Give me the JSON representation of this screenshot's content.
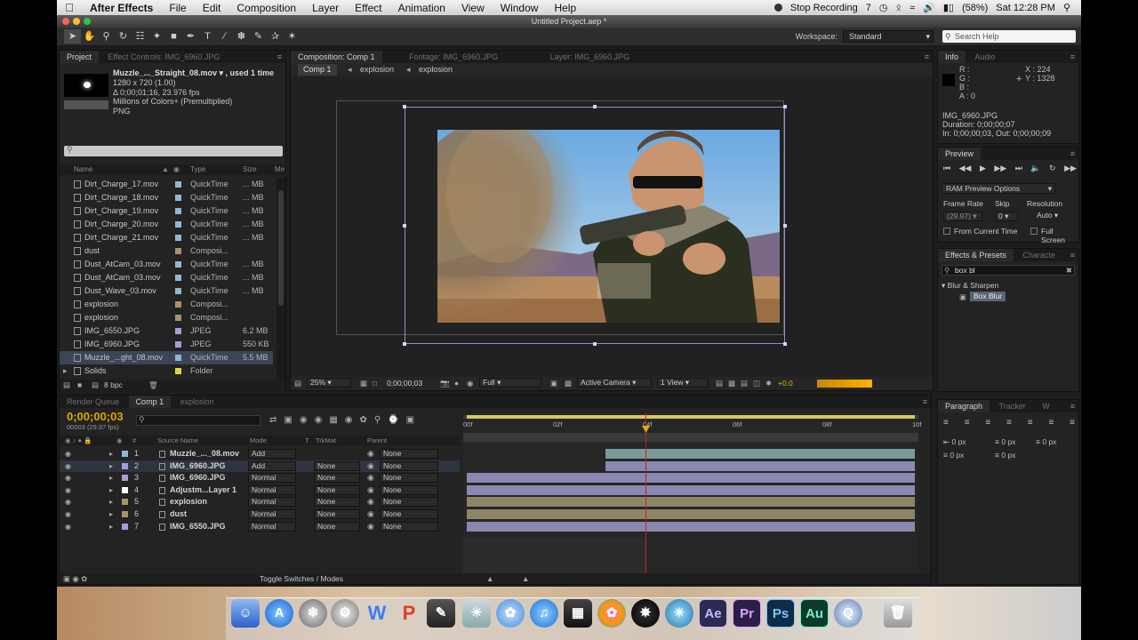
{
  "menubar": {
    "app_name": "After Effects",
    "items": [
      "File",
      "Edit",
      "Composition",
      "Layer",
      "Effect",
      "Animation",
      "View",
      "Window",
      "Help"
    ],
    "stop_recording": "Stop Recording",
    "battery": "(58%)",
    "clock": "Sat 12:28 PM",
    "extra_num": "7"
  },
  "window": {
    "title": "Untitled Project.aep *"
  },
  "toolbar": {
    "workspace_label": "Workspace:",
    "workspace_value": "Standard",
    "search_placeholder": "Search Help"
  },
  "project_panel": {
    "tabs": [
      "Project",
      "Effect Controls: IMG_6960.JPG"
    ],
    "preview_name": "Muzzle_..._Straight_08.mov ▾ , used 1 time",
    "preview_info": [
      "1280 x 720 (1.00)",
      "Δ 0;00;01;16, 23.976 fps",
      "Millions of Colors+ (Premultiplied)",
      "PNG"
    ],
    "columns": {
      "name": "Name",
      "type": "Type",
      "size": "Size",
      "media": "Me"
    },
    "items": [
      {
        "name": "Dirt_Charge_17.mov",
        "type": "QuickTime",
        "size": "... MB",
        "label": "#8fb8d1"
      },
      {
        "name": "Dirt_Charge_18.mov",
        "type": "QuickTime",
        "size": "... MB",
        "label": "#8fb8d1"
      },
      {
        "name": "Dirt_Charge_19.mov",
        "type": "QuickTime",
        "size": "... MB",
        "label": "#8fb8d1"
      },
      {
        "name": "Dirt_Charge_20.mov",
        "type": "QuickTime",
        "size": "... MB",
        "label": "#8fb8d1"
      },
      {
        "name": "Dirt_Charge_21.mov",
        "type": "QuickTime",
        "size": "... MB",
        "label": "#8fb8d1"
      },
      {
        "name": "dust",
        "type": "Composi...",
        "size": "",
        "label": "#a7956a"
      },
      {
        "name": "Dust_AtCam_03.mov",
        "type": "QuickTime",
        "size": "... MB",
        "label": "#8fb8d1"
      },
      {
        "name": "Dust_AtCam_03.mov",
        "type": "QuickTime",
        "size": "... MB",
        "label": "#8fb8d1"
      },
      {
        "name": "Dust_Wave_03.mov",
        "type": "QuickTime",
        "size": "... MB",
        "label": "#8fb8d1"
      },
      {
        "name": "explosion",
        "type": "Composi...",
        "size": "",
        "label": "#a7956a"
      },
      {
        "name": "explosion",
        "type": "Composi...",
        "size": "",
        "label": "#a7956a"
      },
      {
        "name": "IMG_6550.JPG",
        "type": "JPEG",
        "size": "6.2 MB",
        "label": "#a99cd8"
      },
      {
        "name": "IMG_6960.JPG",
        "type": "JPEG",
        "size": "550 KB",
        "label": "#a99cd8"
      },
      {
        "name": "Muzzle_...ght_08.mov",
        "type": "QuickTime",
        "size": "5.5 MB",
        "label": "#8fb8d1"
      },
      {
        "name": "Solids",
        "type": "Folder",
        "size": "",
        "label": "#e3d24a"
      }
    ],
    "bpc": "8 bpc"
  },
  "comp_panel": {
    "tabs": [
      "Composition: Comp 1",
      "Footage: IMG_6960.JPG",
      "Layer: IMG_6960.JPG"
    ],
    "breadcrumbs": [
      "Comp 1",
      "explosion",
      "explosion"
    ],
    "zoom": "25%",
    "timecode": "0;00;00;03",
    "resolution": "Full",
    "camera": "Active Camera",
    "views": "1 View",
    "exposure": "+0.0"
  },
  "info_panel": {
    "tabs": [
      "Info",
      "Audio"
    ],
    "r": "R :",
    "g": "G :",
    "b": "B :",
    "a": "A : 0",
    "x": "X : 224",
    "y": "Y : 1328",
    "file": "IMG_6960.JPG",
    "duration": "Duration: 0;00;00;07",
    "inout": "In: 0;00;00;03, Out: 0;00;00;09"
  },
  "preview_panel": {
    "title": "Preview",
    "ram_options": "RAM Preview Options",
    "frame_rate_label": "Frame Rate",
    "skip_label": "Skip",
    "resolution_label": "Resolution",
    "frame_rate": "(29.97)",
    "skip": "0",
    "resolution": "Auto",
    "from_current": "From Current Time",
    "full_screen": "Full Screen"
  },
  "effects_panel": {
    "tabs": [
      "Effects & Presets",
      "Characte"
    ],
    "search": "box bl",
    "category": "Blur & Sharpen",
    "effect": "Box Blur"
  },
  "paragraph_panel": {
    "tabs": [
      "Paragraph",
      "Tracker",
      "W"
    ],
    "px": [
      "0 px",
      "0 px",
      "0 px",
      "0 px",
      "0 px"
    ]
  },
  "timeline": {
    "tabs": [
      "Render Queue",
      "Comp 1",
      "explosion"
    ],
    "timecode": "0;00;00;03",
    "frame_info": "00003 (29.97 fps)",
    "columns": {
      "source": "Source Name",
      "mode": "Mode",
      "t": "T",
      "trkmat": "TrkMat",
      "parent": "Parent"
    },
    "ruler": [
      "00f",
      "02f",
      "04f",
      "06f",
      "08f",
      "10f"
    ],
    "layers": [
      {
        "num": "1",
        "name": "Muzzle_..._08.mov",
        "mode": "Add",
        "trkmat": "",
        "parent": "None",
        "label": "#8fb8d1",
        "bar_color": "#7a9a97",
        "start": 0.31
      },
      {
        "num": "2",
        "name": "IMG_6960.JPG",
        "mode": "Add",
        "trkmat": "None",
        "parent": "None",
        "label": "#a99cd8",
        "bar_color": "#8a88b0",
        "start": 0.31
      },
      {
        "num": "3",
        "name": "IMG_6960.JPG",
        "mode": "Normal",
        "trkmat": "None",
        "parent": "None",
        "label": "#a99cd8",
        "bar_color": "#8a88b0",
        "start": 0.0
      },
      {
        "num": "4",
        "name": "Adjustm...Layer 1",
        "mode": "Normal",
        "trkmat": "None",
        "parent": "None",
        "label": "#ffffff",
        "bar_color": "#8a88b0",
        "start": 0.0
      },
      {
        "num": "5",
        "name": "explosion",
        "mode": "Normal",
        "trkmat": "None",
        "parent": "None",
        "label": "#a7956a",
        "bar_color": "#8d8566",
        "start": 0.0
      },
      {
        "num": "6",
        "name": "dust",
        "mode": "Normal",
        "trkmat": "None",
        "parent": "None",
        "label": "#a7956a",
        "bar_color": "#8d8566",
        "start": 0.0
      },
      {
        "num": "7",
        "name": "IMG_6550.JPG",
        "mode": "Normal",
        "trkmat": "None",
        "parent": "None",
        "label": "#a99cd8",
        "bar_color": "#8a88b0",
        "start": 0.0
      }
    ],
    "toggle": "Toggle Switches / Modes"
  },
  "dock": {
    "labeled_icons": [
      {
        "text": "Ae",
        "color": "#2b2a4f",
        "fg": "#c9b6ff"
      },
      {
        "text": "Pr",
        "color": "#2a1f48",
        "fg": "#e3a6ff"
      },
      {
        "text": "Ps",
        "color": "#0d2c4a",
        "fg": "#7ec6ff"
      },
      {
        "text": "Au",
        "color": "#0d3a2d",
        "fg": "#74f0c2"
      }
    ]
  }
}
